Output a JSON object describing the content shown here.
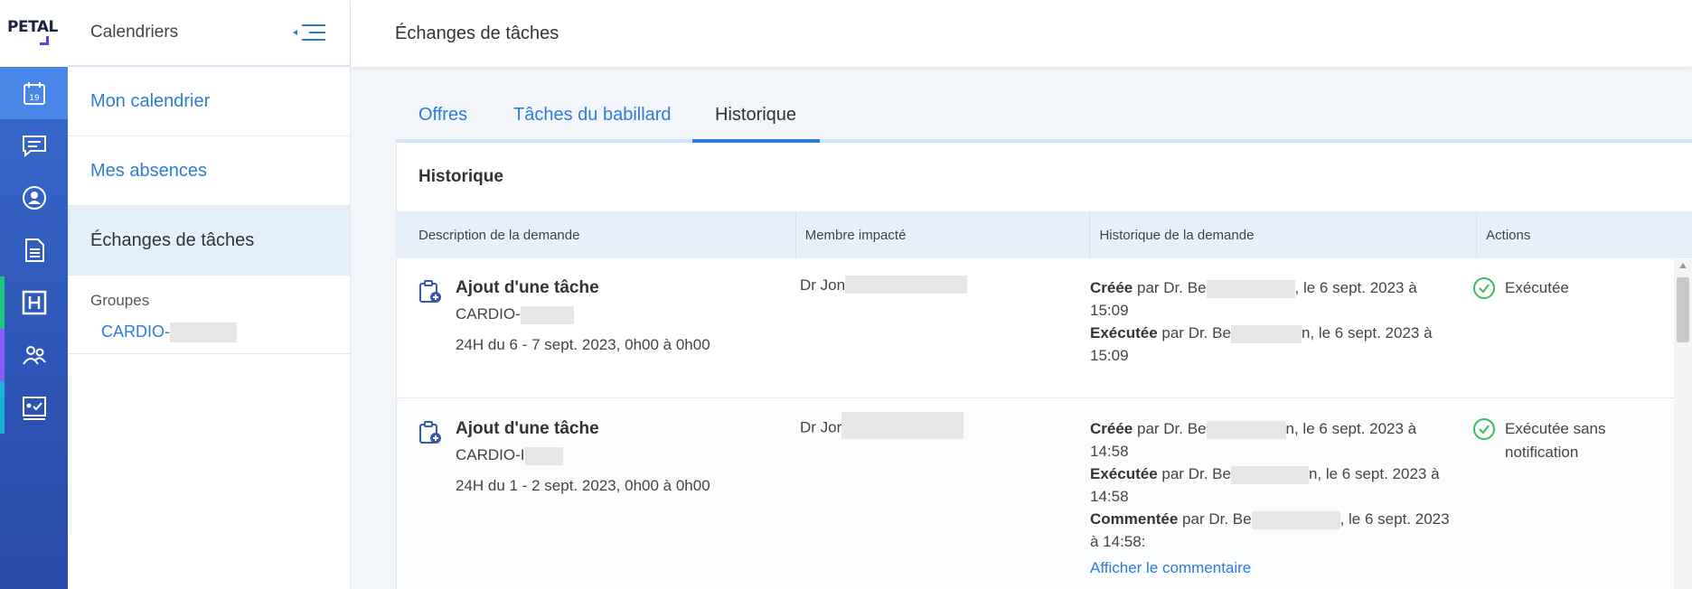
{
  "app": {
    "logo": "PETAL"
  },
  "rail": [
    {
      "icon": "calendar-icon",
      "active": true,
      "badge": "19"
    },
    {
      "icon": "chat-icon"
    },
    {
      "icon": "user-circle-icon"
    },
    {
      "icon": "document-icon"
    },
    {
      "icon": "hospital-icon",
      "accent": "#1ec77a"
    },
    {
      "icon": "team-icon",
      "accent": "#8b5cf6"
    },
    {
      "icon": "presentation-check-icon",
      "accent": "#19b3d6"
    }
  ],
  "subnav": {
    "title": "Calendriers",
    "items": [
      {
        "label": "Mon calendrier"
      },
      {
        "label": "Mes absences"
      },
      {
        "label": "Échanges de tâches",
        "active": true
      }
    ],
    "groups_label": "Groupes",
    "group_link": "CARDIO-"
  },
  "page": {
    "title": "Échanges de tâches"
  },
  "tabs": [
    {
      "label": "Offres"
    },
    {
      "label": "Tâches du babillard"
    },
    {
      "label": "Historique",
      "active": true
    }
  ],
  "card": {
    "title": "Historique",
    "columns": [
      "Description de la demande",
      "Membre impacté",
      "Historique de la demande",
      "Actions"
    ],
    "rows": [
      {
        "title": "Ajout d'une tâche",
        "group": "CARDIO-",
        "date": "24H du 6 - 7 sept. 2023, 0h00 à 0h00",
        "member": "Dr Jon",
        "history": [
          {
            "label": "Créée",
            "pre": " par Dr. Be",
            "post": ", le 6 sept. 2023 à 15:09"
          },
          {
            "label": "Exécutée",
            "pre": " par Dr. Be",
            "post": "n, le 6 sept. 2023 à 15:09"
          }
        ],
        "action": "Exécutée"
      },
      {
        "title": "Ajout d'une tâche",
        "group": "CARDIO-I",
        "date": "24H du 1 - 2 sept. 2023, 0h00 à 0h00",
        "member": "Dr Jor",
        "history": [
          {
            "label": "Créée",
            "pre": " par Dr. Be",
            "post": "n, le 6 sept. 2023 à 14:58"
          },
          {
            "label": "Exécutée",
            "pre": " par Dr. Be",
            "post": "n, le 6 sept. 2023 à 14:58"
          },
          {
            "label": "Commentée",
            "pre": " par Dr. Be",
            "post": ", le 6 sept. 2023 à 14:58:"
          }
        ],
        "link": "Afficher le commentaire",
        "action": "Exécutée sans notification"
      }
    ]
  },
  "colors": {
    "accent": "#2f7bd9",
    "rail": "#2e56b8",
    "success": "#3dbb5b"
  }
}
